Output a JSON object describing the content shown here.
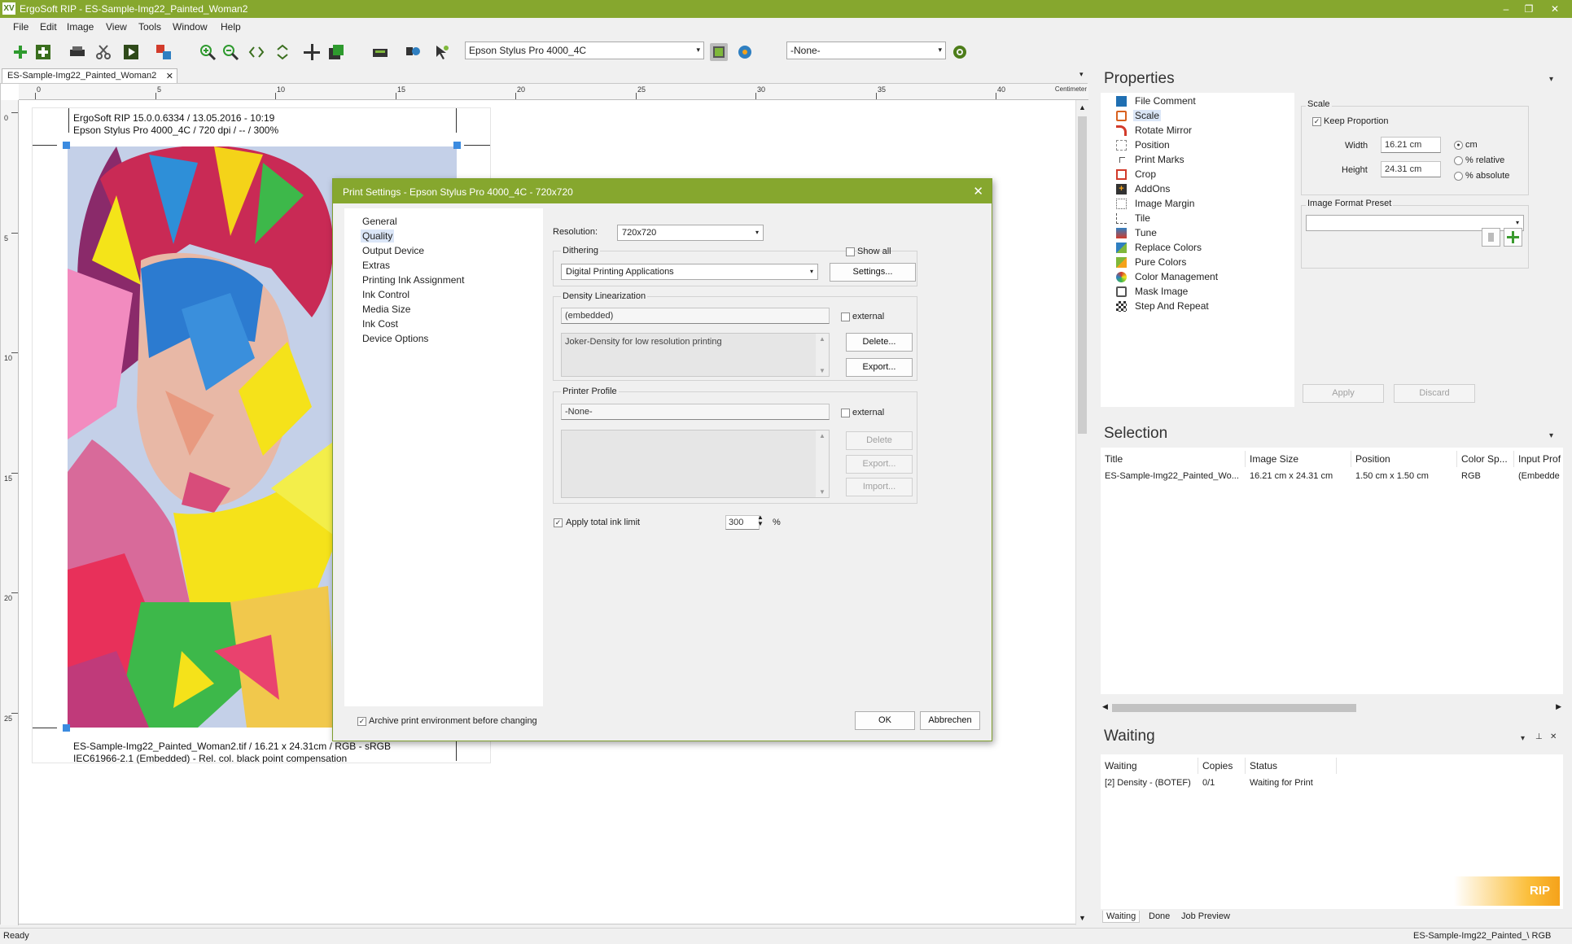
{
  "window": {
    "title": "ErgoSoft RIP - ES-Sample-Img22_Painted_Woman2",
    "logo": "XV",
    "minimize": "–",
    "restore": "❐",
    "close": "✕"
  },
  "menu": [
    "File",
    "Edit",
    "Image",
    "View",
    "Tools",
    "Window",
    "Help"
  ],
  "toolbar": {
    "printer_select": "Epson Stylus Pro  4000_4C",
    "env_select": "-None-",
    "arrow": "▾"
  },
  "document_tab": {
    "label": "ES-Sample-Img22_Painted_Woman2",
    "close": "✕",
    "overflow": "▾"
  },
  "ruler": {
    "unit": "Centimeter",
    "h_labels": [
      "0",
      "5",
      "10",
      "15",
      "20",
      "25",
      "30",
      "35",
      "40"
    ],
    "v_labels": [
      "0",
      "5",
      "10",
      "15",
      "20",
      "25"
    ]
  },
  "page": {
    "header_line1": "ErgoSoft RIP 15.0.0.6334 / 13.05.2016 - 10:19",
    "header_line2": "Epson Stylus Pro  4000_4C / 720 dpi / -- / 300%",
    "footer_line1": "ES-Sample-Img22_Painted_Woman2.tif / 16.21 x 24.31cm / RGB - sRGB",
    "footer_line2": "IEC61966-2.1 (Embedded) - Rel. col. black point compensation"
  },
  "dialog": {
    "title": "Print Settings - Epson Stylus Pro  4000_4C - 720x720",
    "close": "✕",
    "nav": [
      "General",
      "Quality",
      "Output Device",
      "Extras",
      "Printing Ink Assignment",
      "Ink Control",
      "Media Size",
      "Ink Cost",
      "Device Options"
    ],
    "active_nav": "Quality",
    "resolution_label": "Resolution:",
    "resolution_value": "720x720",
    "dithering_label": "Dithering",
    "show_all": "Show all",
    "dithering_value": "Digital Printing Applications",
    "settings_btn": "Settings...",
    "density_label": "Density Linearization",
    "density_value": "(embedded)",
    "external": "external",
    "density_desc": "Joker-Density for low resolution printing",
    "delete_btn": "Delete...",
    "export_btn": "Export...",
    "printer_profile_label": "Printer Profile",
    "profile_value": "-None-",
    "delete_btn2": "Delete",
    "export_btn2": "Export...",
    "import_btn": "Import...",
    "ink_limit_label": "Apply total ink limit",
    "ink_limit_value": "300",
    "ink_limit_unit": "%",
    "archive_label": "Archive print environment before changing",
    "ok_btn": "OK",
    "cancel_btn": "Abbrechen"
  },
  "properties": {
    "title": "Properties",
    "items": [
      "File Comment",
      "Scale",
      "Rotate Mirror",
      "Position",
      "Print Marks",
      "Crop",
      "AddOns",
      "Image Margin",
      "Tile",
      "Tune",
      "Replace Colors",
      "Pure Colors",
      "Color Management",
      "Mask Image",
      "Step And Repeat"
    ],
    "active": "Scale",
    "scale_group": "Scale",
    "keep_proportion": "Keep Proportion",
    "width_label": "Width",
    "width_value": "16.21 cm",
    "height_label": "Height",
    "height_value": "24.31 cm",
    "unit_cm": "cm",
    "unit_relative": "% relative",
    "unit_absolute": "% absolute",
    "preset_label": "Image Format Preset",
    "apply_btn": "Apply",
    "discard_btn": "Discard"
  },
  "selection": {
    "title": "Selection",
    "columns": [
      "Title",
      "Image Size",
      "Position",
      "Color Sp...",
      "Input Prof"
    ],
    "row": [
      "ES-Sample-Img22_Painted_Wo...",
      "16.21 cm x 24.31 cm",
      "1.50 cm x 1.50 cm",
      "RGB",
      "(Embedde"
    ]
  },
  "waiting": {
    "title": "Waiting",
    "pin": "⊥",
    "close": "✕",
    "columns": [
      "Waiting",
      "Copies",
      "Status"
    ],
    "row": [
      "[2]  Density - (BOTEF)",
      "0/1",
      "Waiting for Print"
    ],
    "tabs": [
      "Waiting",
      "Done",
      "Job Preview"
    ],
    "badge": "RIP"
  },
  "status": {
    "left": "Ready",
    "right": "ES-Sample-Img22_Painted_\\  RGB"
  }
}
